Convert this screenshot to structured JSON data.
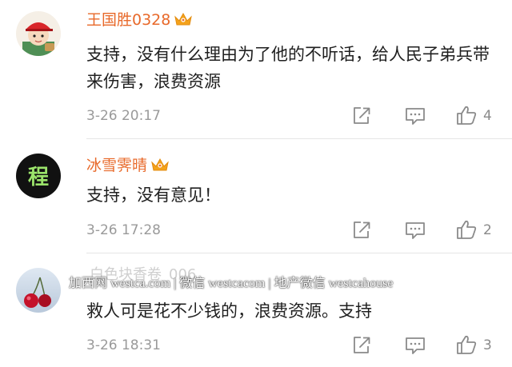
{
  "comments": [
    {
      "username": "王国胜0328",
      "text": "支持，没有什么理由为了他的不听话，给人民子弟兵带来伤害，浪费资源",
      "time": "3-26 20:17",
      "likes": "4",
      "avatar_icon": "cartoon-avatar-red-cap",
      "badge_icon": "crown-icon"
    },
    {
      "username": "冰雪霁晴",
      "text": "支持，没有意见！",
      "time": "3-26 17:28",
      "likes": "2",
      "avatar_icon": "black-avatar-cheng-glyph",
      "badge_icon": "crown-icon"
    },
    {
      "username": "白色块香卷_006",
      "text": "救人可是花不少钱的，浪费资源。支持",
      "time": "3-26 18:31",
      "likes": "3",
      "avatar_icon": "cherry-photo-avatar"
    }
  ],
  "watermark": "加西网 westca.com | 微信 westcacom | 地产微信 westcahouse",
  "colors": {
    "username": "#e8692a",
    "crown": "#f4a21b",
    "text": "#202020",
    "meta": "#9a9a9a"
  }
}
